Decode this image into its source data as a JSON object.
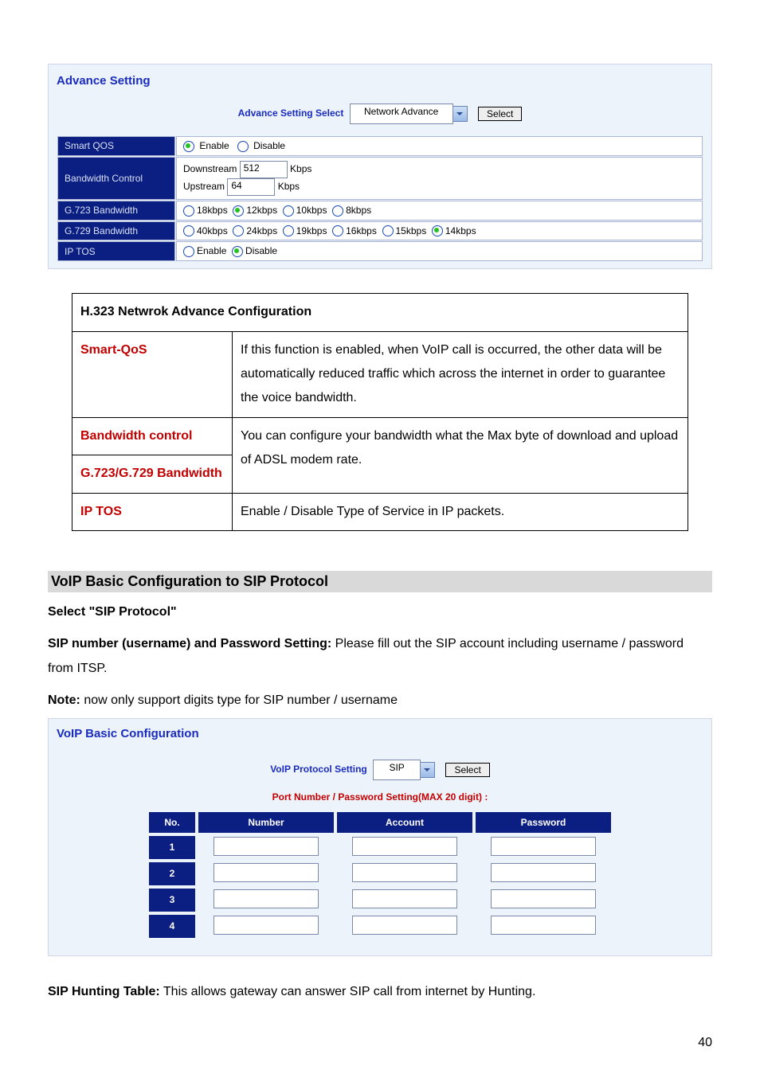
{
  "page_number": "40",
  "shot1": {
    "title": "Advance Setting",
    "select_label": "Advance Setting Select",
    "select_value": "Network Advance",
    "select_btn": "Select",
    "rows": {
      "smart_qos": {
        "label": "Smart QOS",
        "options": {
          "enable": "Enable",
          "disable": "Disable"
        },
        "selected": "enable"
      },
      "bandwidth_control": {
        "label": "Bandwidth Control",
        "down_label": "Downstream",
        "down_value": "512",
        "up_label": "Upstream",
        "up_value": "64",
        "unit": "Kbps"
      },
      "g723": {
        "label": "G.723 Bandwidth",
        "options": [
          "18kbps",
          "12kbps",
          "10kbps",
          "8kbps"
        ],
        "selected_index": 1
      },
      "g729": {
        "label": "G.729 Bandwidth",
        "options": [
          "40kbps",
          "24kbps",
          "19kbps",
          "16kbps",
          "15kbps",
          "14kbps"
        ],
        "selected_index": 5
      },
      "ip_tos": {
        "label": "IP TOS",
        "options": {
          "enable": "Enable",
          "disable": "Disable"
        },
        "selected": "disable"
      }
    }
  },
  "expl": {
    "header": "H.323 Netwrok Advance Configuration",
    "r1_left": "Smart-QoS",
    "r1_right": "If this function is enabled, when VoIP call is occurred, the other data will be automatically reduced traffic which across the internet in order to guarantee the voice bandwidth.",
    "r2_left": "Bandwidth control",
    "r3_left": "G.723/G.729 Bandwidth",
    "r23_right": "You can configure your bandwidth what the Max byte of download and upload of ADSL modem rate.",
    "r4_left": "IP TOS",
    "r4_right": "Enable / Disable Type of Service in IP packets."
  },
  "section2": {
    "heading": "VoIP Basic Configuration to SIP Protocol",
    "line1_bold": "Select \"SIP Protocol\"",
    "line2_bold": "SIP number (username) and Password Setting:",
    "line2_rest": " Please fill out the SIP account including username / password from ITSP.",
    "note_bold": "Note:",
    "note_rest": " now only support digits type for SIP number / username"
  },
  "shot2": {
    "title": "VoIP Basic Configuration",
    "select_label": "VoIP Protocol Setting",
    "select_value": "SIP",
    "select_btn": "Select",
    "sub": "Port Number / Password Setting(MAX 20 digit) :",
    "cols": {
      "no": "No.",
      "number": "Number",
      "account": "Account",
      "password": "Password"
    },
    "rows": [
      "1",
      "2",
      "3",
      "4"
    ]
  },
  "footer": {
    "bold": "SIP Hunting Table:",
    "rest": " This allows gateway can answer SIP call from internet by Hunting."
  }
}
